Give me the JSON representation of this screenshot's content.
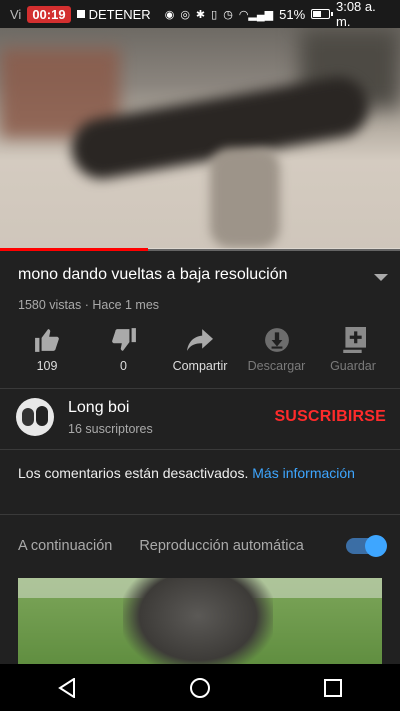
{
  "status_bar": {
    "recording_time": "00:19",
    "stop_label": "DETENER",
    "watermark_partial": "Vi",
    "battery": "51%",
    "battery_level": 0.51,
    "time": "3:08 a. m."
  },
  "video": {
    "progress_fraction": 0.37
  },
  "info": {
    "title": "mono dando vueltas a baja resolución",
    "meta": "1580 vistas · Hace 1 mes"
  },
  "actions": [
    {
      "label": "109",
      "icon": "thumbs-up-icon"
    },
    {
      "label": "0",
      "icon": "thumbs-down-icon"
    },
    {
      "label": "Compartir",
      "icon": "share-icon"
    },
    {
      "label": "Descargar",
      "icon": "download-icon"
    },
    {
      "label": "Guardar",
      "icon": "add-to-playlist-icon"
    }
  ],
  "channel": {
    "name": "Long boi",
    "subscribers": "16 suscriptores",
    "subscribe_label": "SUSCRIBIRSE"
  },
  "comments": {
    "text": "Los comentarios están desactivados.",
    "more": "Más información"
  },
  "up_next": {
    "label": "A continuación",
    "autoplay_label": "Reproducción automática",
    "autoplay_on": true
  },
  "colors": {
    "background": "#212121",
    "accent_red": "#ff0000",
    "link_blue": "#3ea6ff"
  }
}
